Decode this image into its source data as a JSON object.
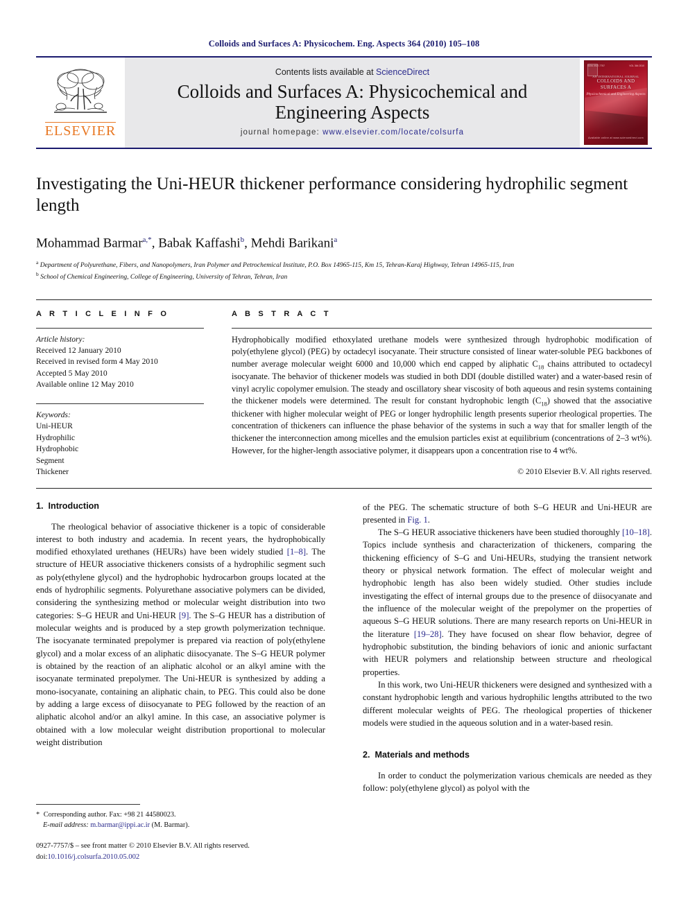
{
  "running_head": "Colloids and Surfaces A: Physicochem. Eng. Aspects 364 (2010) 105–108",
  "masthead": {
    "publisher_name": "ELSEVIER",
    "contents_prefix": "Contents lists available at ",
    "contents_link": "ScienceDirect",
    "journal_title": "Colloids and Surfaces A: Physicochemical and Engineering Aspects",
    "homepage_prefix": "journal homepage:",
    "homepage_url": "www.elsevier.com/locate/colsurfa",
    "cover": {
      "title": "COLLOIDS AND SURFACES A",
      "subtitle": "Physicochemical and Engineering Aspects",
      "kicker": "AN INTERNATIONAL JOURNAL",
      "top_left": "ISSN 0927-7757",
      "top_right": "VOL 364  2010",
      "bottom": "Available online at www.sciencedirect.com"
    }
  },
  "article": {
    "title": "Investigating the Uni-HEUR thickener performance considering hydrophilic segment length",
    "authors_html": "Mohammad Barmar<sup>a,*</sup>, Babak Kaffashi<sup>b</sup>, Mehdi Barikani<sup>a</sup>",
    "affiliation_a": "Department of Polyurethane, Fibers, and Nanopolymers, Iran Polymer and Petrochemical Institute, P.O. Box 14965-115, Km 15, Tehran-Karaj Highway, Tehran 14965-115, Iran",
    "affiliation_b": "School of Chemical Engineering, College of Engineering, University of Tehran, Tehran, Iran"
  },
  "article_info": {
    "heading": "A R T I C L E  I N F O",
    "history_label": "Article history:",
    "history": [
      "Received 12 January 2010",
      "Received in revised form 4 May 2010",
      "Accepted 5 May 2010",
      "Available online 12 May 2010"
    ],
    "keywords_label": "Keywords:",
    "keywords": [
      "Uni-HEUR",
      "Hydrophilic",
      "Hydrophobic",
      "Segment",
      "Thickener"
    ]
  },
  "abstract": {
    "heading": "A B S T R A C T",
    "body_html": "Hydrophobically modified ethoxylated urethane models were synthesized through hydrophobic modification of poly(ethylene glycol) (PEG) by octadecyl isocyanate. Their structure consisted of linear water-soluble PEG backbones of number average molecular weight 6000 and 10,000 which end capped by aliphatic C<sub>18</sub> chains attributed to octadecyl isocyanate. The behavior of thickener models was studied in both DDI (double distilled water) and a water-based resin of vinyl acrylic copolymer emulsion. The steady and oscillatory shear viscosity of both aqueous and resin systems containing the thickener models were determined. The result for constant hydrophobic length (C<sub>18</sub>) showed that the associative thickener with higher molecular weight of PEG or longer hydrophilic length presents superior rheological properties. The concentration of thickeners can influence the phase behavior of the systems in such a way that for smaller length of the thickener the interconnection among micelles and the emulsion particles exist at equilibrium (concentrations of 2–3 wt%). However, for the higher-length associative polymer, it disappears upon a concentration rise to 4 wt%.",
    "copyright": "© 2010 Elsevier B.V. All rights reserved."
  },
  "sections": {
    "intro_number": "1.",
    "intro_title": "Introduction",
    "methods_number": "2.",
    "methods_title": "Materials and methods"
  },
  "body": {
    "left_p1_html": "The rheological behavior of associative thickener is a topic of considerable interest to both industry and academia. In recent years, the hydrophobically modified ethoxylated urethanes (HEURs) have been widely studied <span class=\"ref\">[1–8]</span>. The structure of HEUR associative thickeners consists of a hydrophilic segment such as poly(ethylene glycol) and the hydrophobic hydrocarbon groups located at the ends of hydrophilic segments. Polyurethane associative polymers can be divided, considering the synthesizing method or molecular weight distribution into two categories: S–G HEUR and Uni-HEUR <span class=\"ref\">[9]</span>. The S–G HEUR has a distribution of molecular weights and is produced by a step growth polymerization technique. The isocyanate terminated prepolymer is prepared via reaction of poly(ethylene glycol) and a molar excess of an aliphatic diisocyanate. The S–G HEUR polymer is obtained by the reaction of an aliphatic alcohol or an alkyl amine with the isocyanate terminated prepolymer. The Uni-HEUR is synthesized by adding a mono-isocyanate, containing an aliphatic chain, to PEG. This could also be done by adding a large excess of diisocyanate to PEG followed by the reaction of an aliphatic alcohol and/or an alkyl amine. In this case, an associative polymer is obtained with a low molecular weight distribution proportional to molecular weight distribution",
    "right_p1_html": "of the PEG. The schematic structure of both S–G HEUR and Uni-HEUR are presented in <span class=\"ref\">Fig. 1</span>.",
    "right_p2_html": "The S–G HEUR associative thickeners have been studied thoroughly <span class=\"ref\">[10–18]</span>. Topics include synthesis and characterization of thickeners, comparing the thickening efficiency of S–G and Uni-HEURs, studying the transient network theory or physical network formation. The effect of molecular weight and hydrophobic length has also been widely studied. Other studies include investigating the effect of internal groups due to the presence of diisocyanate and the influence of the molecular weight of the prepolymer on the properties of aqueous S–G HEUR solutions. There are many research reports on Uni-HEUR in the literature <span class=\"ref\">[19–28]</span>. They have focused on shear flow behavior, degree of hydrophobic substitution, the binding behaviors of ionic and anionic surfactant with HEUR polymers and relationship between structure and rheological properties.",
    "right_p3_html": "In this work, two Uni-HEUR thickeners were designed and synthesized with a constant hydrophobic length and various hydrophilic lengths attributed to the two different molecular weights of PEG. The rheological properties of thickener models were studied in the aqueous solution and in a water-based resin.",
    "right_p4_html": "In order to conduct the polymerization various chemicals are needed as they follow: poly(ethylene glycol) as polyol with the"
  },
  "footnotes": {
    "corresponding_html": "<span class=\"star\">*</span> Corresponding author. Fax: +98 21 44580023.",
    "email_label": "E-mail address:",
    "email": "m.barmar@ippi.ac.ir",
    "email_suffix": "(M. Barmar)."
  },
  "colophon": {
    "issn_line": "0927-7757/$ – see front matter © 2010 Elsevier B.V. All rights reserved.",
    "doi_label": "doi:",
    "doi_value": "10.1016/j.colsurfa.2010.05.002"
  },
  "colors": {
    "header_blue": "#1a1a6e",
    "link_blue": "#2a2a8c",
    "elsevier_orange": "#E87722",
    "masthead_grey": "#e8e8ea"
  }
}
